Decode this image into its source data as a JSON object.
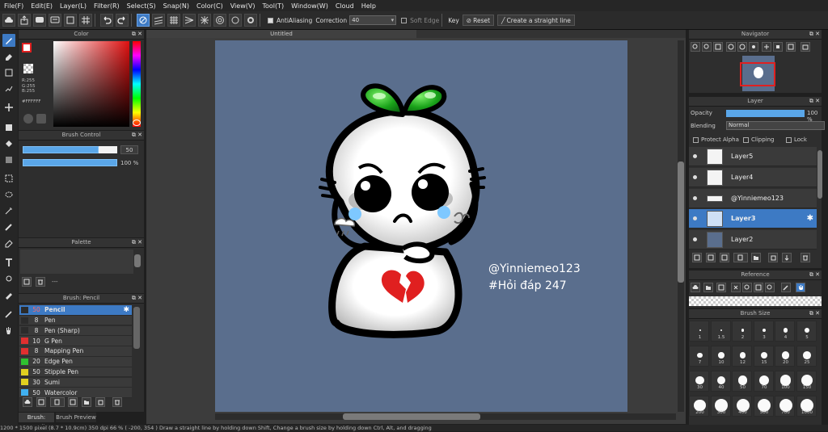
{
  "menu": [
    "File(F)",
    "Edit(E)",
    "Layer(L)",
    "Filter(R)",
    "Select(S)",
    "Snap(N)",
    "Color(C)",
    "View(V)",
    "Tool(T)",
    "Window(W)",
    "Cloud",
    "Help"
  ],
  "toolbar": {
    "antialiasing_label": "AntiAliasing",
    "correction_label": "Correction",
    "correction_value": "40",
    "soft_edge_label": "Soft Edge",
    "key_label": "Key",
    "reset_label": "Reset",
    "straight_line_label": "Create a straight line"
  },
  "color_panel": {
    "title": "Color",
    "r": "R:255",
    "g": "G:255",
    "b": "B:255",
    "hex": "#FFFFFF"
  },
  "brush_control": {
    "title": "Brush Control",
    "size_value": "50",
    "opacity_value": "100 %",
    "size_fraction": 0.8,
    "opacity_fraction": 1.0
  },
  "palette": {
    "title": "Palette",
    "dashes": "---"
  },
  "brush_list": {
    "title": "Brush: Pencil",
    "items": [
      {
        "size": "50",
        "name": "Pencil",
        "color": "#2b2b2b"
      },
      {
        "size": "8",
        "name": "Pen",
        "color": "#2b2b2b"
      },
      {
        "size": "8",
        "name": "Pen (Sharp)",
        "color": "#2b2b2b"
      },
      {
        "size": "10",
        "name": "G Pen",
        "color": "#e03030"
      },
      {
        "size": "8",
        "name": "Mapping Pen",
        "color": "#e03030"
      },
      {
        "size": "20",
        "name": "Edge Pen",
        "color": "#30c030"
      },
      {
        "size": "50",
        "name": "Stipple Pen",
        "color": "#e0d020"
      },
      {
        "size": "30",
        "name": "Sumi",
        "color": "#e0d020"
      },
      {
        "size": "50",
        "name": "Watercolor",
        "color": "#40b0f0"
      }
    ]
  },
  "bottom_tabs": [
    "Brush: Pencil",
    "Brush Preview"
  ],
  "document": {
    "tab_title": "Untitled",
    "text_line1": "@Yinniemeo123",
    "text_line2": "#Hỏi đáp 247"
  },
  "navigator": {
    "title": "Navigator"
  },
  "layer_panel": {
    "title": "Layer",
    "opacity_label": "Opacity",
    "opacity_value": "100 %",
    "blending_label": "Blending",
    "blending_value": "Normal",
    "protect_alpha_label": "Protect Alpha",
    "clipping_label": "Clipping",
    "lock_label": "Lock",
    "layers": [
      {
        "name": "Layer5"
      },
      {
        "name": "Layer4"
      },
      {
        "name": "@Yinniemeo123"
      },
      {
        "name": "Layer3"
      },
      {
        "name": "Layer2"
      }
    ]
  },
  "reference": {
    "title": "Reference"
  },
  "brush_size": {
    "title": "Brush Size",
    "sizes": [
      "1",
      "1.5",
      "2",
      "3",
      "4",
      "5",
      "7",
      "10",
      "12",
      "15",
      "20",
      "25",
      "30",
      "40",
      "50",
      "70",
      "100",
      "150",
      "200",
      "300",
      "400",
      "500",
      "700",
      "1000"
    ]
  },
  "status": {
    "text": "1200 * 1500 pixel   (8.7 * 10.9cm)   350 dpi   66 %   ( -200, 354 )   Draw a straight line by holding down Shift, Change a brush size by holding down Ctrl, Alt, and dragging"
  },
  "colors": {
    "accent": "#3d7ac4",
    "canvas_bg": "#5a6e8d",
    "app_bg": "#1f1f1f"
  }
}
